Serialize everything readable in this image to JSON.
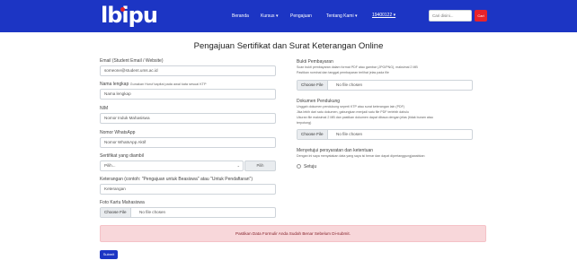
{
  "navbar": {
    "logo": "lbipu",
    "items": [
      "Beranda",
      "Kursus ▾",
      "Pengajuan",
      "Tentang Kami ▾"
    ],
    "user": "19400122 ▾",
    "search_placeholder": "Cari disini...",
    "search_button": "Cari"
  },
  "page_title": "Pengajuan Sertifikat dan Surat Keterangan Online",
  "left": {
    "email": {
      "label": "Email (Student Email / Website)",
      "value": "someone@student.ums.ac.id"
    },
    "nama": {
      "label": "Nama lengkap",
      "hint": "Gunakan Huruf kapital pada awal kata sesuai KTP",
      "value": "Nama lengkap"
    },
    "nim": {
      "label": "NIM",
      "value": "Nomor Induk Mahasiswa"
    },
    "whatsapp": {
      "label": "Nomor WhatsApp",
      "value": "Nomor WhatsApp Aktif"
    },
    "sertifikat": {
      "label": "Sertifikat yang diambil",
      "value": "Pilih...",
      "addon": "Pilih"
    },
    "keterangan": {
      "label": "Keterangan (contoh: \"Pengajuan untuk Beasiswa\" atau \"Untuk Pendaftaran\")",
      "value": "Keterangan"
    },
    "foto": {
      "label": "Foto Kartu Mahasiswa",
      "button": "Choose File",
      "text": "No file chosen"
    }
  },
  "right": {
    "bukti": {
      "label": "Bukti Pembayaran",
      "help": [
        "Scan bukti pembayaran dalam format PDF atau gambar (JPG/PNG), maksimal 2 MB",
        "Pastikan nominal dan tanggal pembayaran terlihat jelas pada file"
      ],
      "button": "Choose File",
      "text": "No file chosen"
    },
    "pendukung": {
      "label": "Dokumen Pendukung",
      "help": [
        "Unggah dokumen pendukung seperti KTP atau surat keterangan lain (PDF)",
        "Jika lebih dari satu dokumen, gabungkan menjadi satu file PDF terlebih dahulu",
        "Ukuran file maksimal 2 MB dan pastikan dokumen dapat dibaca dengan jelas (tidak buram atau",
        "terpotong)"
      ],
      "button": "Choose File",
      "text": "No file chosen"
    },
    "persetujuan": {
      "label": "Menyetujui persyaratan dan ketentuan",
      "help": "Dengan ini saya menyatakan data yang saya isi benar dan dapat dipertanggungjawabkan",
      "option": "Setuju"
    }
  },
  "alert": "Pastikan Data Formulir Anda Sudah Benar Sebelum Di-submit.",
  "submit_label": "Submit",
  "colors": {
    "navbar": "#1c35c4",
    "accent_red": "#e8232a",
    "alert_bg": "#f8d7da"
  }
}
